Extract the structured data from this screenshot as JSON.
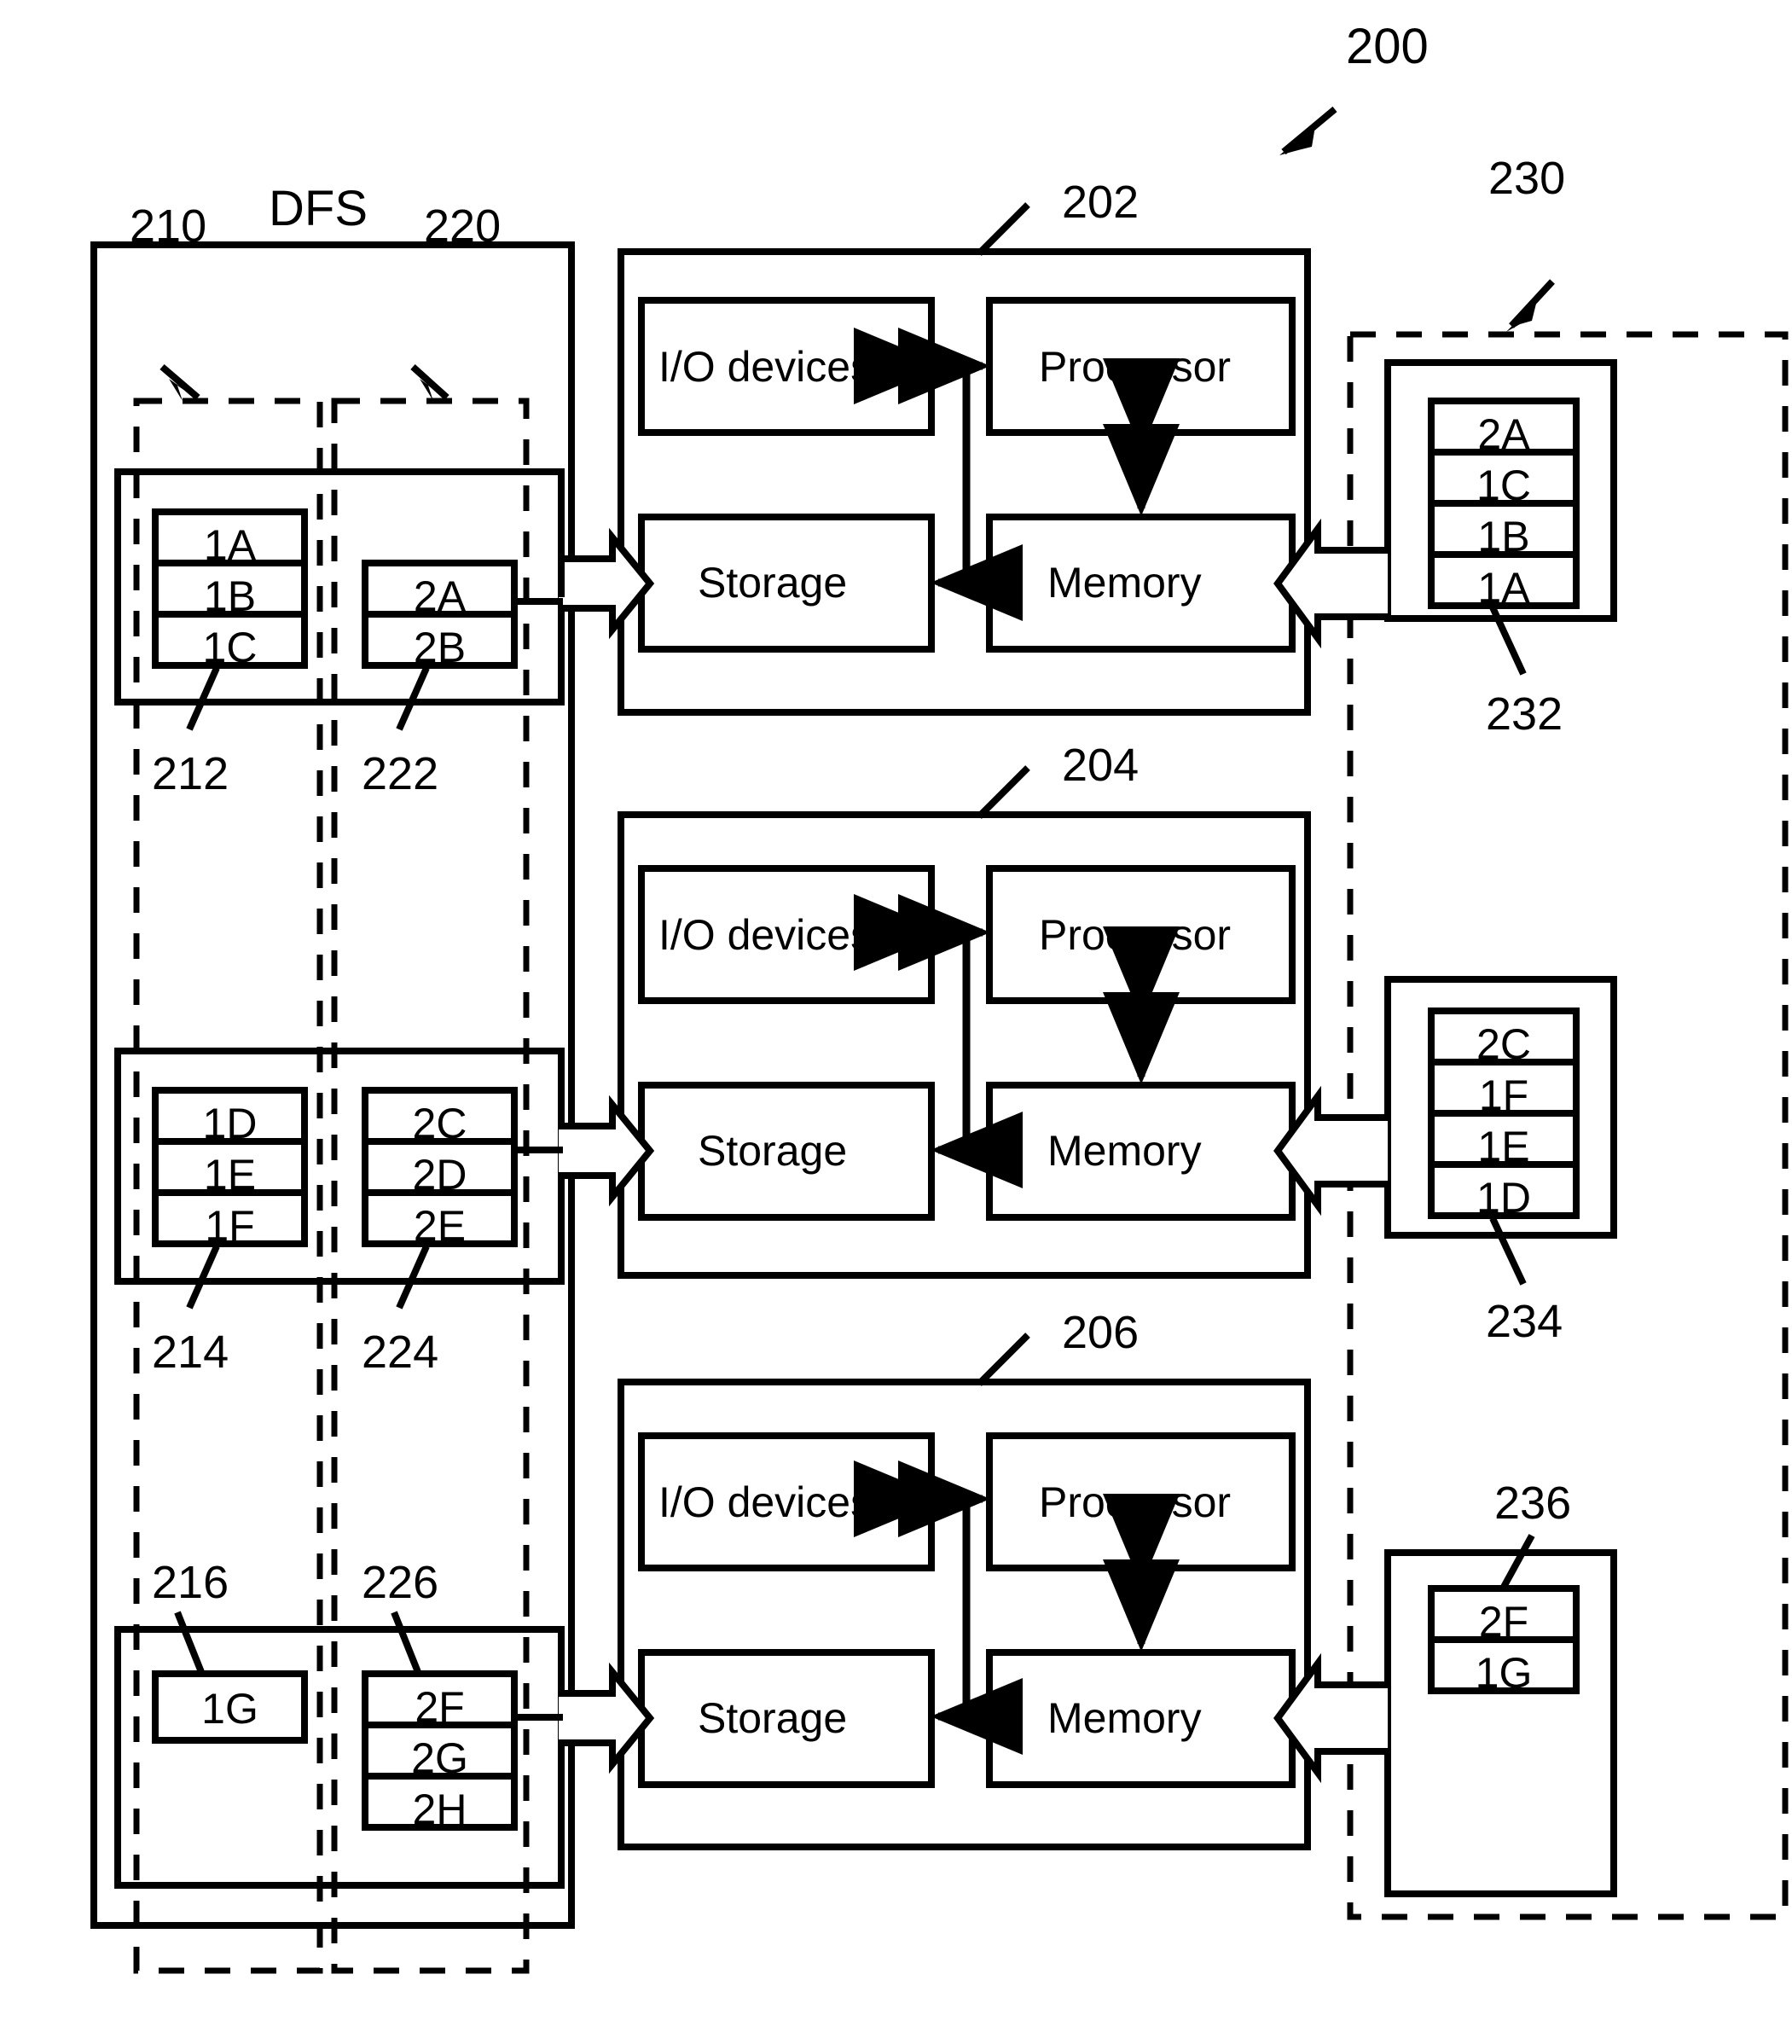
{
  "figure": {
    "root_label": "200",
    "dfs_title": "DFS",
    "colors": {
      "stroke": "#000000",
      "background": "#ffffff"
    }
  },
  "dfs": {
    "title": "DFS",
    "group_labels": {
      "left": "210",
      "right": "220"
    },
    "rows": [
      {
        "left_stack_label": "212",
        "left_stack_cells": [
          "1A",
          "1B",
          "1C"
        ],
        "right_stack_label": "222",
        "right_stack_cells": [
          "2A",
          "2B"
        ]
      },
      {
        "left_stack_label": "214",
        "left_stack_cells": [
          "1D",
          "1E",
          "1F"
        ],
        "right_stack_label": "224",
        "right_stack_cells": [
          "2C",
          "2D",
          "2E"
        ]
      },
      {
        "left_stack_label": "216",
        "left_stack_cells": [
          "1G"
        ],
        "right_stack_label": "226",
        "right_stack_cells": [
          "2F",
          "2G",
          "2H"
        ]
      }
    ]
  },
  "nodes": [
    {
      "label": "202",
      "blocks": {
        "io": "I/O devices",
        "processor": "Processor",
        "storage": "Storage",
        "memory": "Memory"
      }
    },
    {
      "label": "204",
      "blocks": {
        "io": "I/O devices",
        "processor": "Processor",
        "storage": "Storage",
        "memory": "Memory"
      }
    },
    {
      "label": "206",
      "blocks": {
        "io": "I/O devices",
        "processor": "Processor",
        "storage": "Storage",
        "memory": "Memory"
      }
    }
  ],
  "cache_group": {
    "label": "230",
    "stacks": [
      {
        "label": "232",
        "cells": [
          "2A",
          "1C",
          "1B",
          "1A"
        ]
      },
      {
        "label": "234",
        "cells": [
          "2C",
          "1F",
          "1E",
          "1D"
        ]
      },
      {
        "label": "236",
        "cells": [
          "2F",
          "1G"
        ]
      }
    ]
  }
}
